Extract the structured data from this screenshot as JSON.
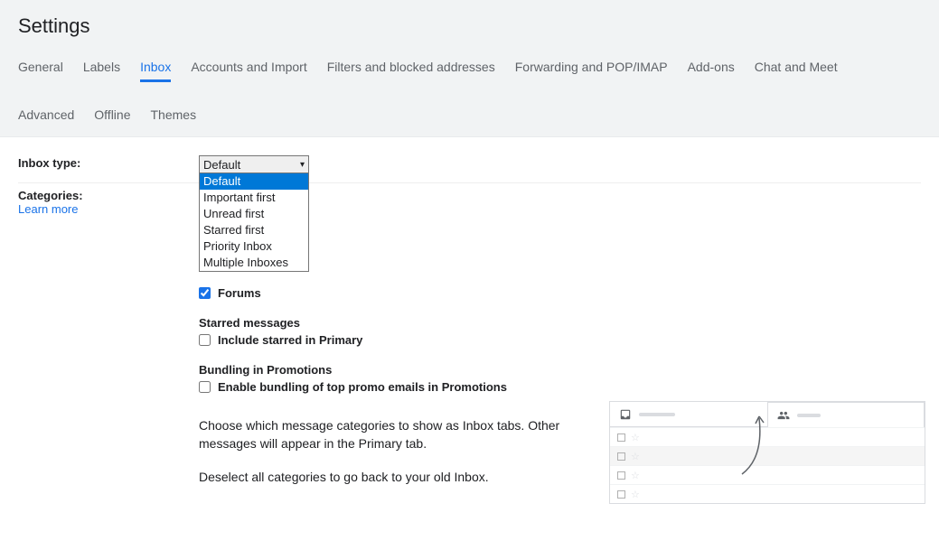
{
  "title": "Settings",
  "tabs_row1": [
    "General",
    "Labels",
    "Inbox",
    "Accounts and Import",
    "Filters and blocked addresses",
    "Forwarding and POP/IMAP",
    "Add-ons",
    "Chat and Meet"
  ],
  "tabs_row2": [
    "Advanced",
    "Offline",
    "Themes"
  ],
  "active_tab": "Inbox",
  "inbox_type": {
    "label": "Inbox type:",
    "selected": "Default",
    "options": [
      "Default",
      "Important first",
      "Unread first",
      "Starred first",
      "Priority Inbox",
      "Multiple Inboxes"
    ]
  },
  "categories": {
    "label": "Categories:",
    "learn_more": "Learn more",
    "forums": {
      "label": "Forums",
      "checked": true
    },
    "starred_heading": "Starred messages",
    "include_starred": {
      "label": "Include starred in Primary",
      "checked": false
    },
    "bundling_heading": "Bundling in Promotions",
    "enable_bundling": {
      "label": "Enable bundling of top promo emails in Promotions",
      "checked": false
    },
    "desc1": "Choose which message categories to show as Inbox tabs. Other messages will appear in the Primary tab.",
    "desc2": "Deselect all categories to go back to your old Inbox."
  }
}
